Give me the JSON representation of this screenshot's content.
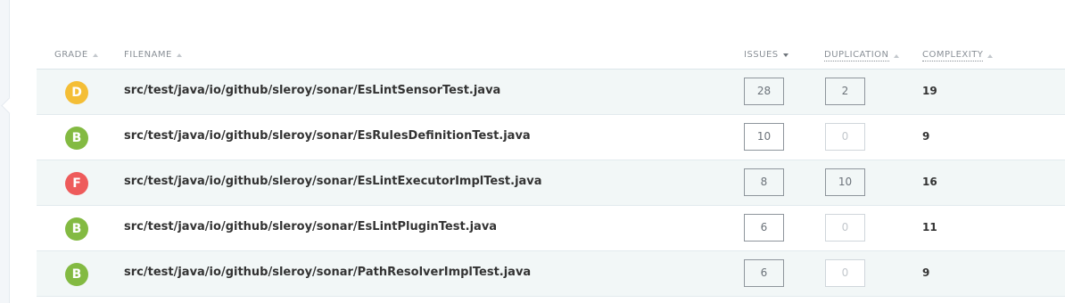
{
  "colors": {
    "grade_D": "#f4be36",
    "grade_B": "#83ba42",
    "grade_F": "#ee5b5b"
  },
  "header": {
    "grade": "GRADE",
    "filename": "FILENAME",
    "issues": "ISSUES",
    "duplication": "DUPLICATION",
    "complexity": "COMPLEXITY"
  },
  "rows": [
    {
      "grade": "D",
      "filename": "src/test/java/io/github/sleroy/sonar/EsLintSensorTest.java",
      "issues": "28",
      "duplication": "2",
      "complexity": "19"
    },
    {
      "grade": "B",
      "filename": "src/test/java/io/github/sleroy/sonar/EsRulesDefinitionTest.java",
      "issues": "10",
      "duplication": "0",
      "complexity": "9"
    },
    {
      "grade": "F",
      "filename": "src/test/java/io/github/sleroy/sonar/EsLintExecutorImplTest.java",
      "issues": "8",
      "duplication": "10",
      "complexity": "16"
    },
    {
      "grade": "B",
      "filename": "src/test/java/io/github/sleroy/sonar/EsLintPluginTest.java",
      "issues": "6",
      "duplication": "0",
      "complexity": "11"
    },
    {
      "grade": "B",
      "filename": "src/test/java/io/github/sleroy/sonar/PathResolverImplTest.java",
      "issues": "6",
      "duplication": "0",
      "complexity": "9"
    }
  ]
}
